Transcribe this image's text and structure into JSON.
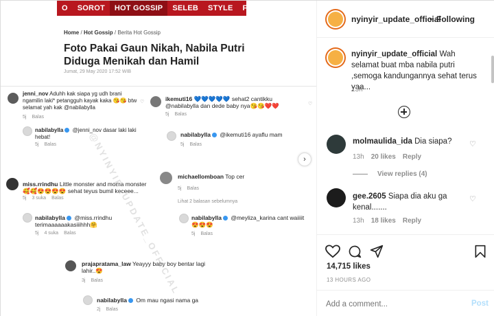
{
  "article": {
    "nav": [
      "O",
      "SOROT",
      "HOT GOSSIP",
      "SELEB",
      "STYLE",
      "FILM & MU"
    ],
    "breadcrumb_home": "Home",
    "breadcrumb_sep1": "/",
    "breadcrumb_cat": "Hot Gossip",
    "breadcrumb_sep2": "/",
    "breadcrumb_page": "Berita Hot Gossip",
    "headline": "Foto Pakai Gaun Nikah, Nabila Putri Diduga Menikah dan Hamil",
    "date": "Jumat, 29 May 2020 17:52 WIB",
    "more_replies": "Lihat 2 balasan sebelumnya",
    "watermark": "@NYINYIR_UPDATE_OFFICIAL",
    "arrow": "›",
    "comments": [
      {
        "user": "jenni_nov",
        "text": "Aduhh kak siapa yg udh brani ngamilin laki* petangguh kayak kaka 😘😘 btw selamat yah kak @nabilabylla",
        "meta": [
          "5j",
          "Balas"
        ]
      },
      {
        "user": "nabilabylla",
        "text": "@jenni_nov dasar laki laki hebat!",
        "meta": [
          "5j",
          "Balas"
        ]
      },
      {
        "user": "ikemuti16",
        "text": "💙💙💙💙💙 sehat2 cantikku @nabilabylla dan dede baby nya😘😘❤️❤️",
        "meta": [
          "5j",
          "Balas"
        ]
      },
      {
        "user": "nabilabylla",
        "text": "@ikemuti16 ayaflu mam",
        "meta": [
          "5j",
          "Balas"
        ]
      },
      {
        "user": "miss.rrindhu",
        "text": "Little monster and moma monster 🥰🥰😍😍😍😍 sehat teyus bumil keceee...",
        "meta": [
          "5j",
          "3 suka",
          "Balas"
        ]
      },
      {
        "user": "michaellomboan",
        "text": "Top cer",
        "meta": [
          "5j",
          "Balas"
        ]
      },
      {
        "user": "nabilabylla",
        "text": "@miss.rrindhu terimaaaaaakasiiihhh🤗",
        "meta": [
          "5j",
          "4 suka",
          "Balas"
        ]
      },
      {
        "user": "nabilabylla",
        "text": "@meyliza_karina cant waiiiit 😍😍😍",
        "meta": [
          "5j",
          "Balas"
        ]
      },
      {
        "user": "prajapratama_law",
        "text": "Yeayyy baby boy bentar lagi lahir..😍",
        "meta": [
          "3j",
          "Balas"
        ]
      },
      {
        "user": "nabilabylla",
        "text": "Om mau ngasi nama ga",
        "meta": [
          "2j",
          "Balas"
        ]
      }
    ]
  },
  "post": {
    "account": "nyinyir_update_official",
    "separator": "•",
    "follow_state": "Following",
    "caption_user": "nyinyir_update_official",
    "caption_text": "Wah selamat buat mba nabila putri ,semoga kandungannya sehat terus yaa...",
    "caption_time": "13h",
    "comments": [
      {
        "user": "molmaulida_ida",
        "text": "Dia siapa?",
        "time": "13h",
        "likes": "20 likes",
        "reply": "Reply"
      },
      {
        "user": "gee.2605",
        "text": "Siapa dia aku ga kenal.......",
        "time": "13h",
        "likes": "18 likes",
        "reply": "Reply"
      }
    ],
    "view_replies": "View replies (4)",
    "likes_count": "14,715 likes",
    "time_ago": "13 HOURS AGO",
    "add_comment_placeholder": "Add a comment...",
    "post_label": "Post",
    "icons": {
      "like": "♡",
      "comment": "◯",
      "share": "➤",
      "save": "⚑",
      "heart_small": "♡"
    }
  }
}
